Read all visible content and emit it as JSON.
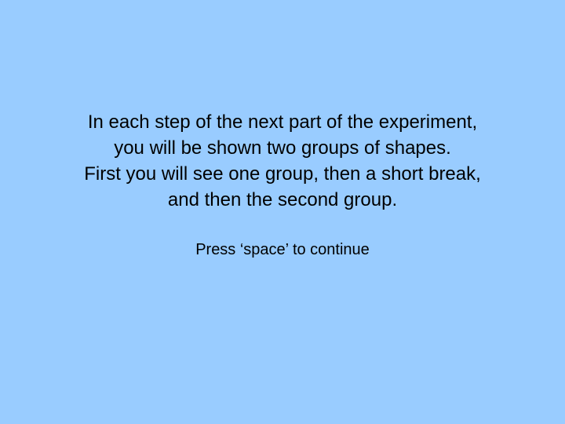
{
  "screen": {
    "background_color": "#99ccff",
    "text_color": "#000000",
    "instruction_lines": [
      "In each step of the next part of the experiment,",
      "you will be shown two groups of shapes.",
      "First you will see one group, then a short break,",
      "and then the second group."
    ],
    "continue_prompt": "Press ‘space’ to continue"
  }
}
